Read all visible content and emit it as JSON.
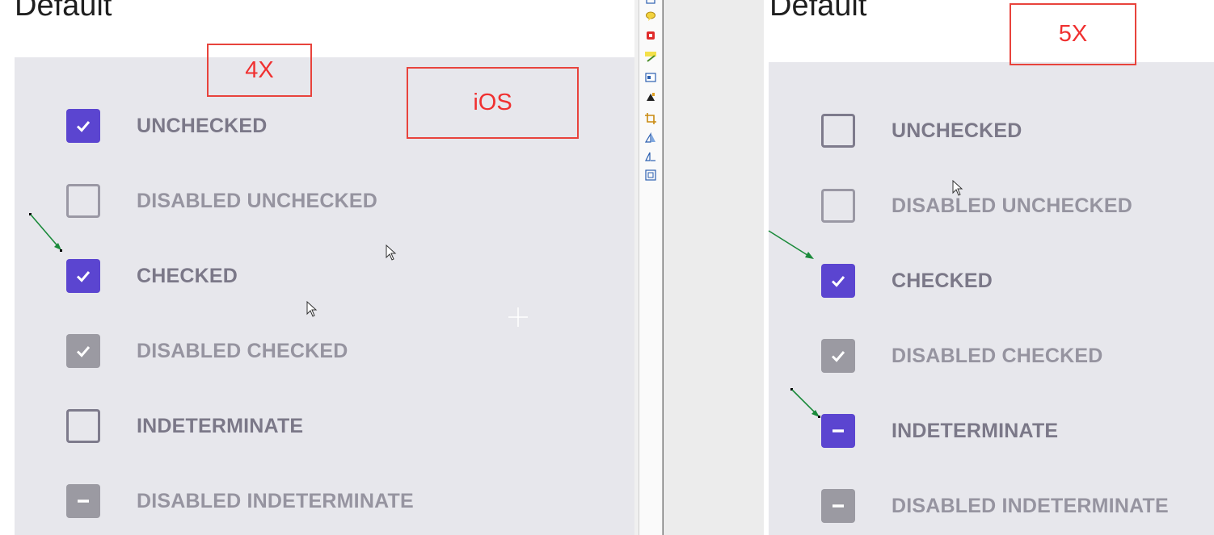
{
  "left": {
    "heading": "Default",
    "tag_scale": "4X",
    "tag_platform": "iOS",
    "items": [
      {
        "label": "UNCHECKED",
        "state": "checked"
      },
      {
        "label": "DISABLED UNCHECKED",
        "state": "disabled-unchecked"
      },
      {
        "label": "CHECKED",
        "state": "checked"
      },
      {
        "label": "DISABLED CHECKED",
        "state": "disabled-checked"
      },
      {
        "label": "INDETERMINATE",
        "state": "unchecked"
      },
      {
        "label": "DISABLED INDETERMINATE",
        "state": "disabled-indeterminate"
      }
    ]
  },
  "right": {
    "heading": "Default",
    "tag_scale": "5X",
    "items": [
      {
        "label": "UNCHECKED",
        "state": "unchecked"
      },
      {
        "label": "DISABLED UNCHECKED",
        "state": "disabled-unchecked"
      },
      {
        "label": "CHECKED",
        "state": "checked"
      },
      {
        "label": "DISABLED CHECKED",
        "state": "disabled-checked"
      },
      {
        "label": "INDETERMINATE",
        "state": "indeterminate"
      },
      {
        "label": "DISABLED INDETERMINATE",
        "state": "disabled-indeterminate"
      }
    ]
  },
  "colors": {
    "accent": "#5b45d0",
    "disabled_fill": "#9b9aa2",
    "card_bg": "#e7e7ec",
    "annotation_red": "#f03030",
    "arrow_green": "#1a8a3a"
  },
  "toolbar_icons": [
    "stamp-icon",
    "callout-icon",
    "red-box-icon",
    "spellcheck-icon",
    "image-icon",
    "fill-icon",
    "crop-icon",
    "flip-icon",
    "rotate-icon",
    "frame-icon"
  ]
}
